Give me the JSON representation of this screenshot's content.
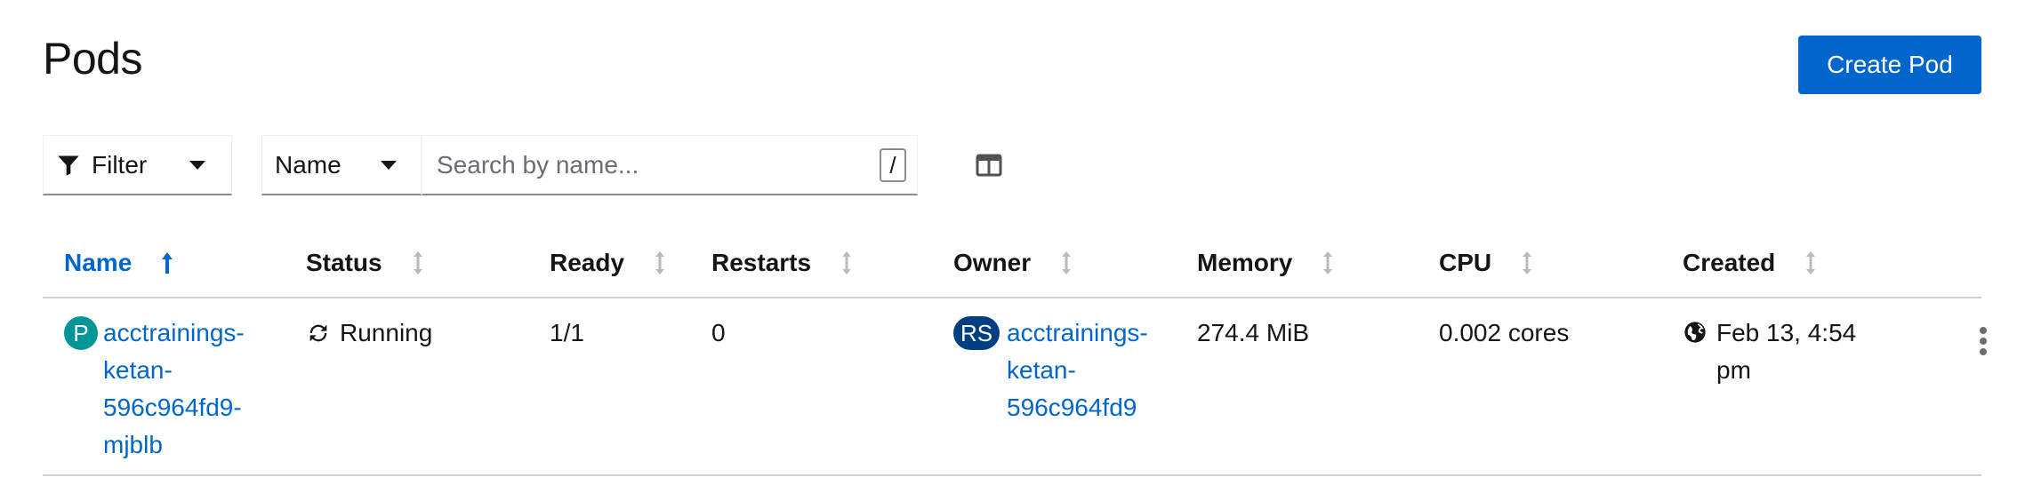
{
  "page": {
    "title": "Pods"
  },
  "actions": {
    "create_label": "Create Pod"
  },
  "toolbar": {
    "filter_label": "Filter",
    "name_select_label": "Name",
    "search_placeholder": "Search by name...",
    "search_value": "",
    "shortcut_key": "/"
  },
  "table": {
    "columns": [
      "Name",
      "Status",
      "Ready",
      "Restarts",
      "Owner",
      "Memory",
      "CPU",
      "Created"
    ],
    "sorted_column": "Name",
    "rows": [
      {
        "name_badge": "P",
        "name_lines": [
          "acctrainings-",
          "ketan-",
          "596c964fd9-",
          "mjblb"
        ],
        "status": "Running",
        "ready": "1/1",
        "restarts": "0",
        "owner_badge": "RS",
        "owner_lines": [
          "acctrainings-",
          "ketan-",
          "596c964fd9"
        ],
        "memory": "274.4 MiB",
        "cpu": "0.002 cores",
        "created_lines": [
          "Feb 13, 4:54",
          "pm"
        ]
      }
    ]
  },
  "colors": {
    "accent": "#0066cc",
    "pod_badge": "#009596",
    "owner_badge": "#004080"
  },
  "icons": [
    "filter-icon",
    "caret-down-icon",
    "columns-icon",
    "sort-asc-icon",
    "sort-icon",
    "sync-icon",
    "globe-icon",
    "kebab-icon"
  ]
}
